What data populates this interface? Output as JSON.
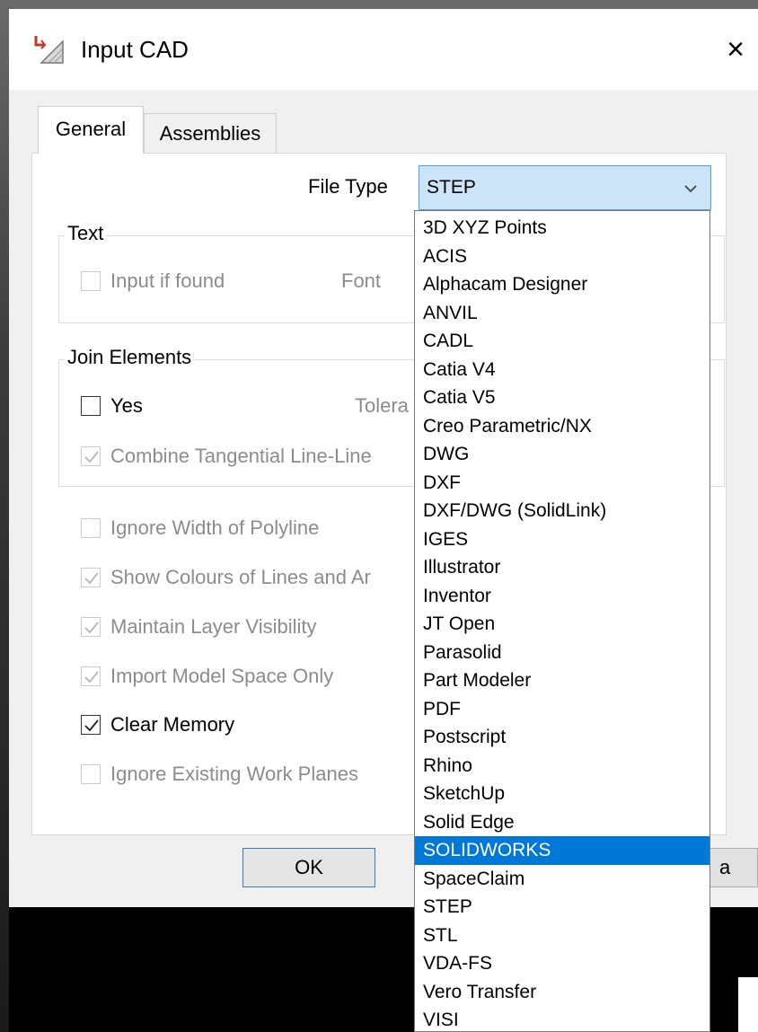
{
  "dialog": {
    "title": "Input CAD",
    "close_glyph": "×"
  },
  "tabs": [
    {
      "label": "General",
      "active": true
    },
    {
      "label": "Assemblies",
      "active": false
    }
  ],
  "file_type": {
    "label": "File Type",
    "value": "STEP",
    "options": [
      "3D XYZ Points",
      "ACIS",
      "Alphacam Designer",
      "ANVIL",
      "CADL",
      "Catia V4",
      "Catia V5",
      "Creo Parametric/NX",
      "DWG",
      "DXF",
      "DXF/DWG (SolidLink)",
      "IGES",
      "Illustrator",
      "Inventor",
      "JT Open",
      "Parasolid",
      "Part Modeler",
      "PDF",
      "Postscript",
      "Rhino",
      "SketchUp",
      "Solid Edge",
      "SOLIDWORKS",
      "SpaceClaim",
      "STEP",
      "STL",
      "VDA-FS",
      "Vero Transfer",
      "VISI"
    ],
    "highlighted": "SOLIDWORKS"
  },
  "text_group": {
    "title": "Text",
    "input_if_found": {
      "label": "Input if found",
      "checked": false,
      "enabled": false
    },
    "font_label": "Font"
  },
  "join_group": {
    "title": "Join Elements",
    "yes": {
      "label": "Yes",
      "checked": false,
      "enabled": true
    },
    "tolerance_label": "Tolera",
    "combine": {
      "label": "Combine Tangential Line-Line",
      "checked": true,
      "enabled": false
    }
  },
  "options": {
    "ignore_width": {
      "label": "Ignore Width of Polyline",
      "checked": false,
      "enabled": false
    },
    "show_colours": {
      "label": "Show Colours of Lines and Ar",
      "checked": true,
      "enabled": false
    },
    "maintain_layer": {
      "label": "Maintain Layer Visibility",
      "checked": true,
      "enabled": false
    },
    "model_space": {
      "label": "Import Model Space Only",
      "checked": true,
      "enabled": false
    },
    "clear_memory": {
      "label": "Clear Memory",
      "checked": true,
      "enabled": true
    },
    "ignore_work_planes": {
      "label": "Ignore Existing Work Planes",
      "checked": false,
      "enabled": false
    }
  },
  "buttons": {
    "ok": "OK",
    "cancel_partial": "a"
  },
  "icons": {
    "app": "input-cad-icon",
    "close": "close-icon",
    "dropdown": "chevron-down-icon",
    "check": "checkmark-icon"
  },
  "colors": {
    "selection": "#0078d7",
    "combo_bg": "#cce4f7",
    "combo_border": "#569de5"
  }
}
